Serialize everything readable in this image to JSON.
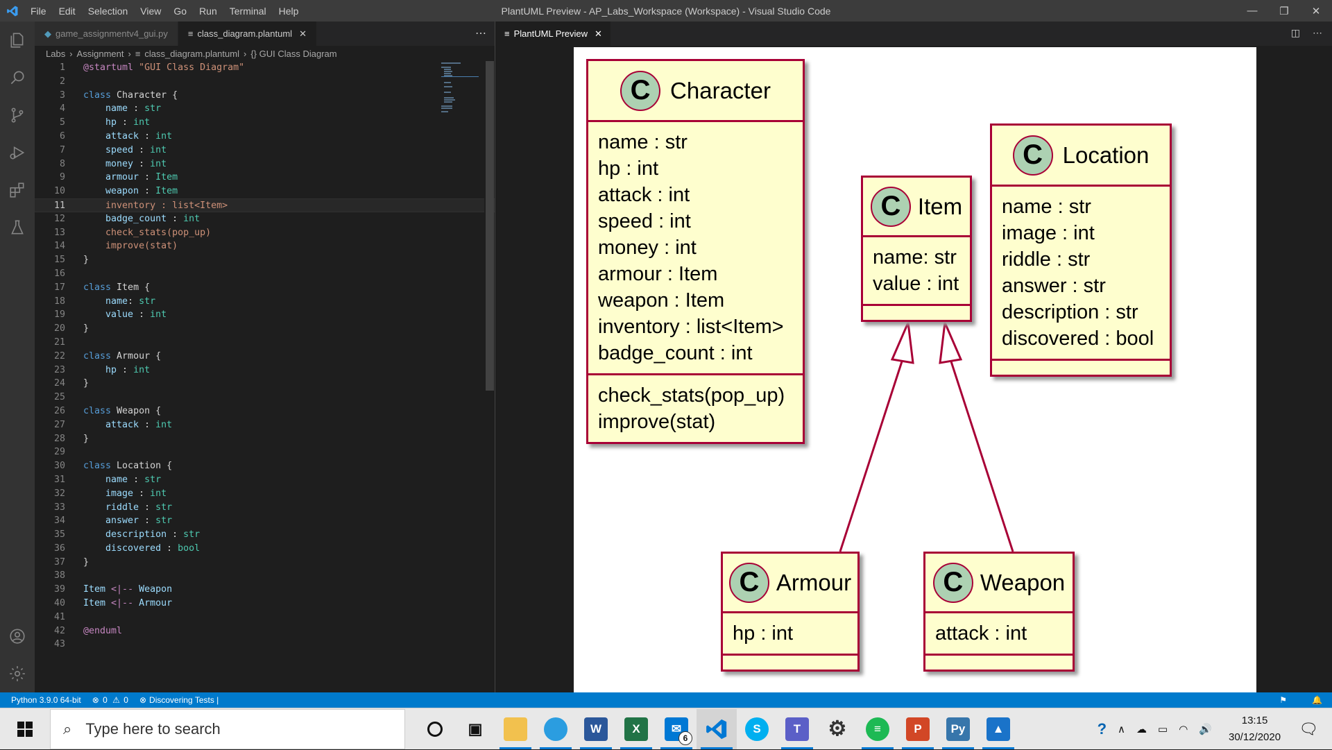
{
  "window": {
    "title": "PlantUML Preview - AP_Labs_Workspace (Workspace) - Visual Studio Code",
    "logo": "vscode-icon"
  },
  "menu": [
    "File",
    "Edit",
    "Selection",
    "View",
    "Go",
    "Run",
    "Terminal",
    "Help"
  ],
  "editor_tabs": [
    {
      "label": "game_assignmentv4_gui.py",
      "icon": "python-file-icon"
    },
    {
      "label": "class_diagram.plantuml",
      "icon": "file-lines-icon",
      "active": true
    }
  ],
  "breadcrumb": [
    "Labs",
    "Assignment",
    "class_diagram.plantuml",
    "{} GUI Class Diagram"
  ],
  "current_line": 11,
  "code_lines": [
    "@startuml \"GUI Class Diagram\"",
    "",
    "class Character {",
    "    name : str",
    "    hp : int",
    "    attack : int",
    "    speed : int",
    "    money : int",
    "    armour : Item",
    "    weapon : Item",
    "    inventory : list<Item>",
    "    badge_count : int",
    "    check_stats(pop_up)",
    "    improve(stat)",
    "}",
    "",
    "class Item {",
    "    name: str",
    "    value : int",
    "}",
    "",
    "class Armour {",
    "    hp : int",
    "}",
    "",
    "class Weapon {",
    "    attack : int",
    "}",
    "",
    "class Location {",
    "    name : str",
    "    image : int",
    "    riddle : str",
    "    answer : str",
    "    description : str",
    "    discovered : bool",
    "}",
    "",
    "Item <|-- Weapon",
    "Item <|-- Armour",
    "",
    "@enduml",
    ""
  ],
  "preview_tab": {
    "label": "PlantUML Preview"
  },
  "classes": {
    "character": {
      "name": "Character",
      "fields": [
        "name : str",
        "hp : int",
        "attack : int",
        "speed : int",
        "money : int",
        "armour : Item",
        "weapon : Item",
        "inventory : list<Item>",
        "badge_count : int"
      ],
      "methods": [
        "check_stats(pop_up)",
        "improve(stat)"
      ]
    },
    "item": {
      "name": "Item",
      "fields": [
        "name: str",
        "value : int"
      ]
    },
    "location": {
      "name": "Location",
      "fields": [
        "name : str",
        "image : int",
        "riddle : str",
        "answer : str",
        "description : str",
        "discovered : bool"
      ]
    },
    "armour": {
      "name": "Armour",
      "fields": [
        "hp : int"
      ]
    },
    "weapon": {
      "name": "Weapon",
      "fields": [
        "attack : int"
      ]
    },
    "stereotype_letter": "C"
  },
  "status": {
    "python": "Python 3.9.0 64-bit",
    "errors": "0",
    "warnings": "0",
    "tests": "Discovering Tests |"
  },
  "taskbar": {
    "search_placeholder": "Type here to search",
    "mail_badge": "6",
    "time": "13:15",
    "date": "30/12/2020"
  },
  "colors": {
    "accent": "#007acc",
    "uml_border": "#a80036",
    "uml_fill": "#fefece",
    "uml_circle": "#add1b2"
  }
}
